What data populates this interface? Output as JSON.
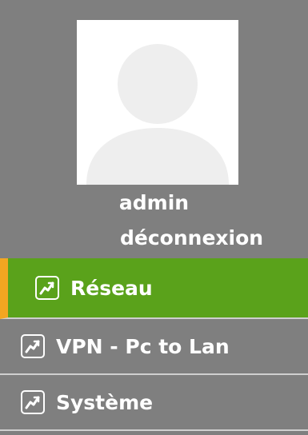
{
  "user": {
    "name": "admin",
    "logout_label": "déconnexion"
  },
  "nav": {
    "items": [
      {
        "label": "Réseau",
        "icon": "chart-line-icon",
        "active": true
      },
      {
        "label": "VPN - Pc to Lan",
        "icon": "chart-line-icon",
        "active": false
      },
      {
        "label": "Système",
        "icon": "chart-line-icon",
        "active": false
      }
    ]
  },
  "colors": {
    "sidebar_bg": "#7f7f7f",
    "active_bg": "#5aa21b",
    "active_marker": "#f3a621",
    "text": "#ffffff"
  }
}
